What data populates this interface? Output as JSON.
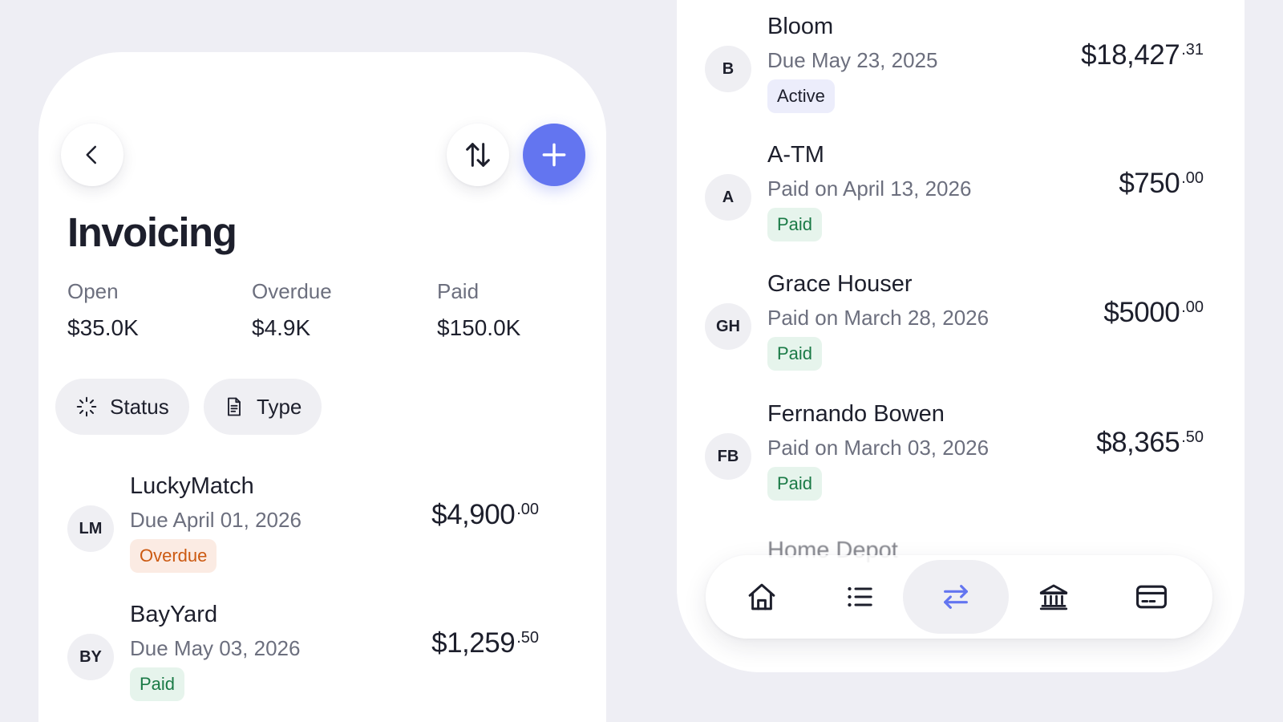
{
  "header": {
    "title": "Invoicing"
  },
  "summary": [
    {
      "label": "Open",
      "value": "$35.0K"
    },
    {
      "label": "Overdue",
      "value": "$4.9K"
    },
    {
      "label": "Paid",
      "value": "$150.0K"
    }
  ],
  "filters": {
    "status_label": "Status",
    "type_label": "Type"
  },
  "left_invoices": [
    {
      "initials": "LM",
      "name": "LuckyMatch",
      "date": "Due April 01, 2026",
      "status": "Overdue",
      "amount_main": "$4,900",
      "amount_cents": ".00"
    },
    {
      "initials": "BY",
      "name": "BayYard",
      "date": "Due May 03, 2026",
      "status": "Paid",
      "amount_main": "$1,259",
      "amount_cents": ".50"
    }
  ],
  "right_invoices": [
    {
      "initials": "B",
      "name": "Bloom",
      "date": "Due May 23, 2025",
      "status": "Active",
      "amount_main": "$18,427",
      "amount_cents": ".31"
    },
    {
      "initials": "A",
      "name": "A-TM",
      "date": "Paid on April 13, 2026",
      "status": "Paid",
      "amount_main": "$750",
      "amount_cents": ".00"
    },
    {
      "initials": "GH",
      "name": "Grace Houser",
      "date": "Paid on March 28, 2026",
      "status": "Paid",
      "amount_main": "$5000",
      "amount_cents": ".00"
    },
    {
      "initials": "FB",
      "name": "Fernando Bowen",
      "date": "Paid on March 03, 2026",
      "status": "Paid",
      "amount_main": "$8,365",
      "amount_cents": ".50"
    }
  ],
  "partial_row_name": "Home Depot",
  "nav": {
    "items": [
      "home-icon",
      "list-icon",
      "transfer-icon",
      "bank-icon",
      "card-icon"
    ],
    "active": "transfer-icon"
  },
  "colors": {
    "accent": "#6375f0",
    "background": "#eeeef4",
    "overdue": "#cc5a12",
    "paid": "#1a7a46"
  }
}
